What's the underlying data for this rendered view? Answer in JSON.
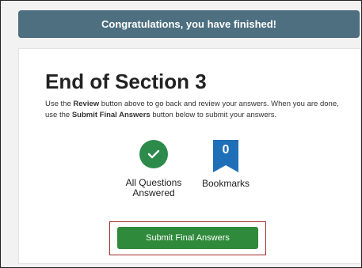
{
  "banner": {
    "text": "Congratulations, you have finished!"
  },
  "section": {
    "title": "End of Section 3",
    "desc_part1": "Use the ",
    "desc_review": "Review",
    "desc_part2": " button above to go back and review your answers. When you are done, use the ",
    "desc_submit": "Submit Final Answers",
    "desc_part3": " button below to submit your answers."
  },
  "stats": {
    "answered_label": "All Questions Answered",
    "answered_icon": "check-icon",
    "bookmarks_count": "0",
    "bookmarks_label": "Bookmarks",
    "bookmarks_icon": "bookmark-icon"
  },
  "submit": {
    "label": "Submit Final Answers"
  },
  "colors": {
    "banner": "#4d6f80",
    "check": "#2c8a4a",
    "bookmark": "#1e6fb8",
    "submit": "#2f8a3b",
    "highlight_border": "#a32b2b"
  }
}
